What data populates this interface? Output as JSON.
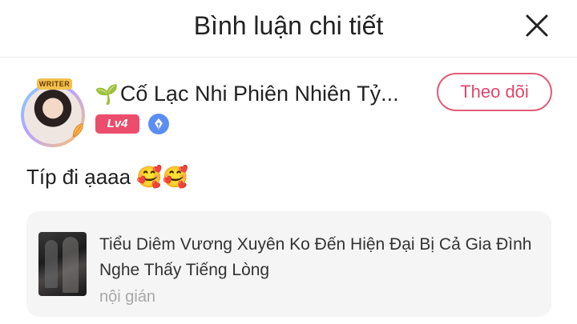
{
  "header": {
    "title": "Bình luận chi tiết",
    "close_icon": "close-icon"
  },
  "user": {
    "avatar_frame_label": "WRITER",
    "prefix_icon": "sprout-icon",
    "prefix_glyph": "🌱",
    "name": "Cố Lạc Nhi Phiên Nhiên Tỷ...",
    "level": "Lv4",
    "badge_icon": "pen-nib-icon",
    "follow_label": "Theo dõi"
  },
  "comment": {
    "text": "Típ đi ạaaa",
    "emojis": [
      "🥰",
      "🥰"
    ]
  },
  "book": {
    "title": "Tiểu Diêm Vương Xuyên Ko Đến Hiện Đại Bị Cả Gia Đình Nghe Thấy Tiếng Lòng",
    "tag": "nội gián"
  },
  "colors": {
    "accent": "#e0466a",
    "level_badge": "#ec4d6c",
    "pen_badge": "#5a8ef5",
    "card_bg": "#f5f5f5",
    "muted_text": "#a8a8a8"
  }
}
